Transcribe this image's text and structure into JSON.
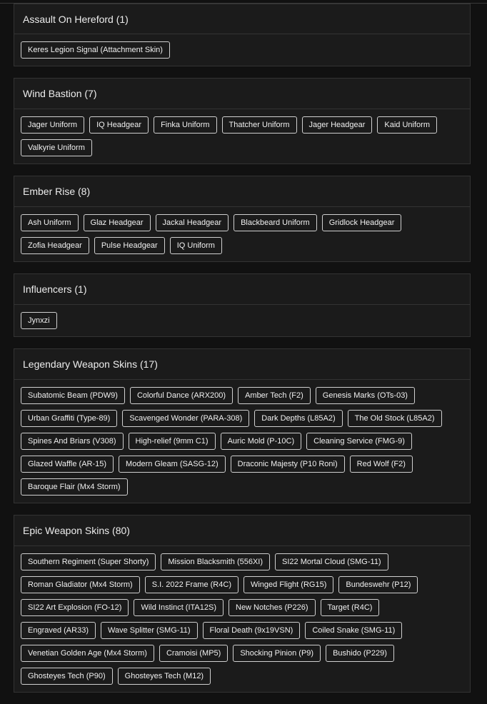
{
  "sections": [
    {
      "title": "Assault On Hereford (1)",
      "items": [
        "Keres Legion Signal (Attachment Skin)"
      ]
    },
    {
      "title": "Wind Bastion (7)",
      "items": [
        "Jager Uniform",
        "IQ Headgear",
        "Finka Uniform",
        "Thatcher Uniform",
        "Jager Headgear",
        "Kaid Uniform",
        "Valkyrie Uniform"
      ]
    },
    {
      "title": "Ember Rise (8)",
      "items": [
        "Ash Uniform",
        "Glaz Headgear",
        "Jackal Headgear",
        "Blackbeard Uniform",
        "Gridlock Headgear",
        "Zofia Headgear",
        "Pulse Headgear",
        "IQ Uniform"
      ]
    },
    {
      "title": "Influencers (1)",
      "items": [
        "Jynxzi"
      ]
    },
    {
      "title": "Legendary Weapon Skins (17)",
      "items": [
        "Subatomic Beam (PDW9)",
        "Colorful Dance (ARX200)",
        "Amber Tech (F2)",
        "Genesis Marks (OTs-03)",
        "Urban Graffiti (Type-89)",
        "Scavenged Wonder (PARA-308)",
        "Dark Depths (L85A2)",
        "The Old Stock (L85A2)",
        "Spines And Briars (V308)",
        "High-relief (9mm C1)",
        "Auric Mold (P-10C)",
        "Cleaning Service (FMG-9)",
        "Glazed Waffle (AR-15)",
        "Modern Gleam (SASG-12)",
        "Draconic Majesty (P10 Roni)",
        "Red Wolf (F2)",
        "Baroque Flair (Mx4 Storm)"
      ]
    },
    {
      "title": "Epic Weapon Skins (80)",
      "items": [
        "Southern Regiment (Super Shorty)",
        "Mission Blacksmith (556XI)",
        "SI22 Mortal Cloud (SMG-11)",
        "Roman Gladiator (Mx4 Storm)",
        "S.I. 2022 Frame (R4C)",
        "Winged Flight (RG15)",
        "Bundeswehr (P12)",
        "SI22 Art Explosion (FO-12)",
        "Wild Instinct (ITA12S)",
        "New Notches (P226)",
        "Target (R4C)",
        "Engraved (AR33)",
        "Wave Splitter (SMG-11)",
        "Floral Death (9x19VSN)",
        "Coiled Snake (SMG-11)",
        "Venetian Golden Age (Mx4 Storm)",
        "Cramoisi (MP5)",
        "Shocking Pinion (P9)",
        "Bushido (P229)",
        "Ghosteyes Tech (P90)",
        "Ghosteyes Tech (M12)"
      ]
    }
  ]
}
